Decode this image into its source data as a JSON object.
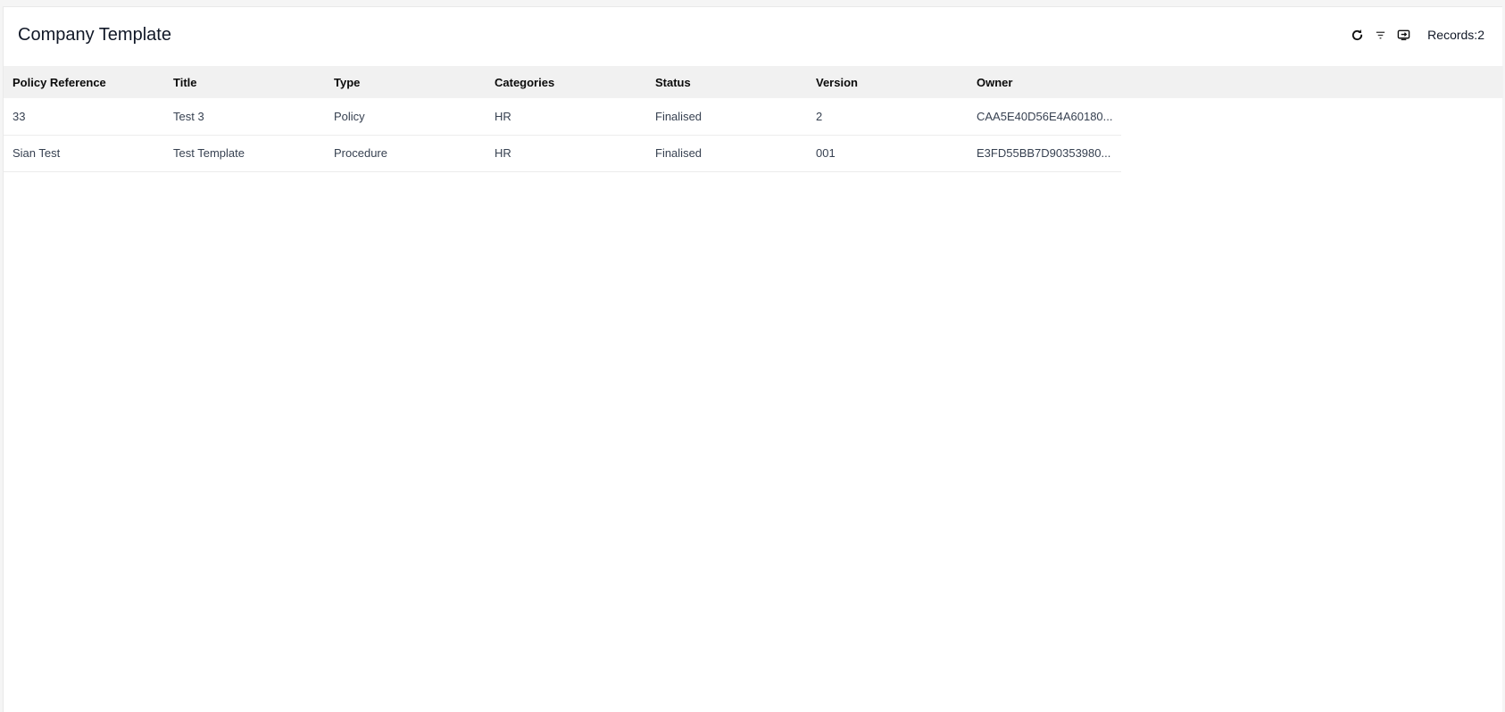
{
  "header": {
    "title": "Company Template",
    "records_label": "Records:",
    "records_count": "2",
    "icons": [
      "refresh-icon",
      "filter-icon",
      "export-icon"
    ]
  },
  "table": {
    "columns": [
      "Policy Reference",
      "Title",
      "Type",
      "Categories",
      "Status",
      "Version",
      "Owner"
    ],
    "rows": [
      [
        "33",
        "Test 3",
        "Policy",
        "HR",
        "Finalised",
        "2",
        "CAA5E40D56E4A60180..."
      ],
      [
        "Sian Test",
        "Test Template",
        "Procedure",
        "HR",
        "Finalised",
        "001",
        "E3FD55BB7D90353980..."
      ]
    ]
  }
}
